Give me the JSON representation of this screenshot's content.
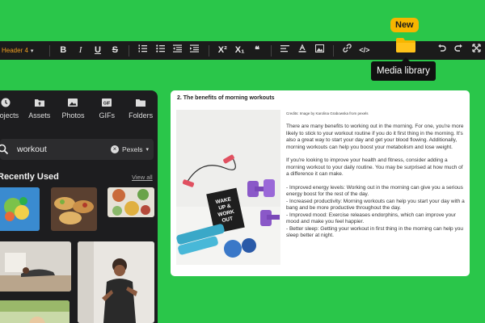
{
  "toolbar": {
    "heading_label": "Header 4",
    "bold": "B",
    "italic": "I",
    "underline": "U",
    "strike": "S",
    "superscript": "X²",
    "subscript": "X₁",
    "quote": "❝",
    "code": "</>"
  },
  "media": {
    "new_badge": "New",
    "tooltip": "Media library"
  },
  "panel": {
    "tabs": [
      {
        "label": "Projects",
        "icon": "projects-icon"
      },
      {
        "label": "Assets",
        "icon": "upload-icon"
      },
      {
        "label": "Photos",
        "icon": "image-icon"
      },
      {
        "label": "GIFs",
        "icon": "gif-icon"
      },
      {
        "label": "Folders",
        "icon": "folder-icon"
      }
    ],
    "search": {
      "query": "workout",
      "source": "Pexels"
    },
    "recent_title": "Recently Used",
    "view_all": "View all"
  },
  "doc": {
    "title": "2. The benefits of morning workouts",
    "credit": "Credits: Image by Karolina Grabowska from pexels",
    "photo_text": "WAKE UP & WORKOUT",
    "para1": "There are many benefits to working out in the morning. For one, you're more likely to stick to your workout routine if you do it first thing in the morning. It's also a great way to start your day and get your blood flowing. Additionally, morning workouts can help you boost your metabolism and lose weight.",
    "para2": "If you're looking to improve your health and fitness, consider adding a morning workout to your daily routine. You may be surprised at how much of a difference it can make.",
    "bullets": [
      "- Improved energy levels: Working out in the morning can give you a serious energy boost for the rest of the day.",
      "- Increased productivity: Morning workouts can help you start your day with a bang and be more productive throughout the day.",
      "- Improved mood: Exercise releases endorphins, which can improve your mood and make you feel happier.",
      "- Better sleep: Getting your workout in first thing in the morning can help you sleep better at night."
    ]
  },
  "colors": {
    "background": "#2ac64a",
    "toolbar": "#1b1b1b",
    "accent": "#f7b500",
    "panel": "#1d1d1f"
  }
}
